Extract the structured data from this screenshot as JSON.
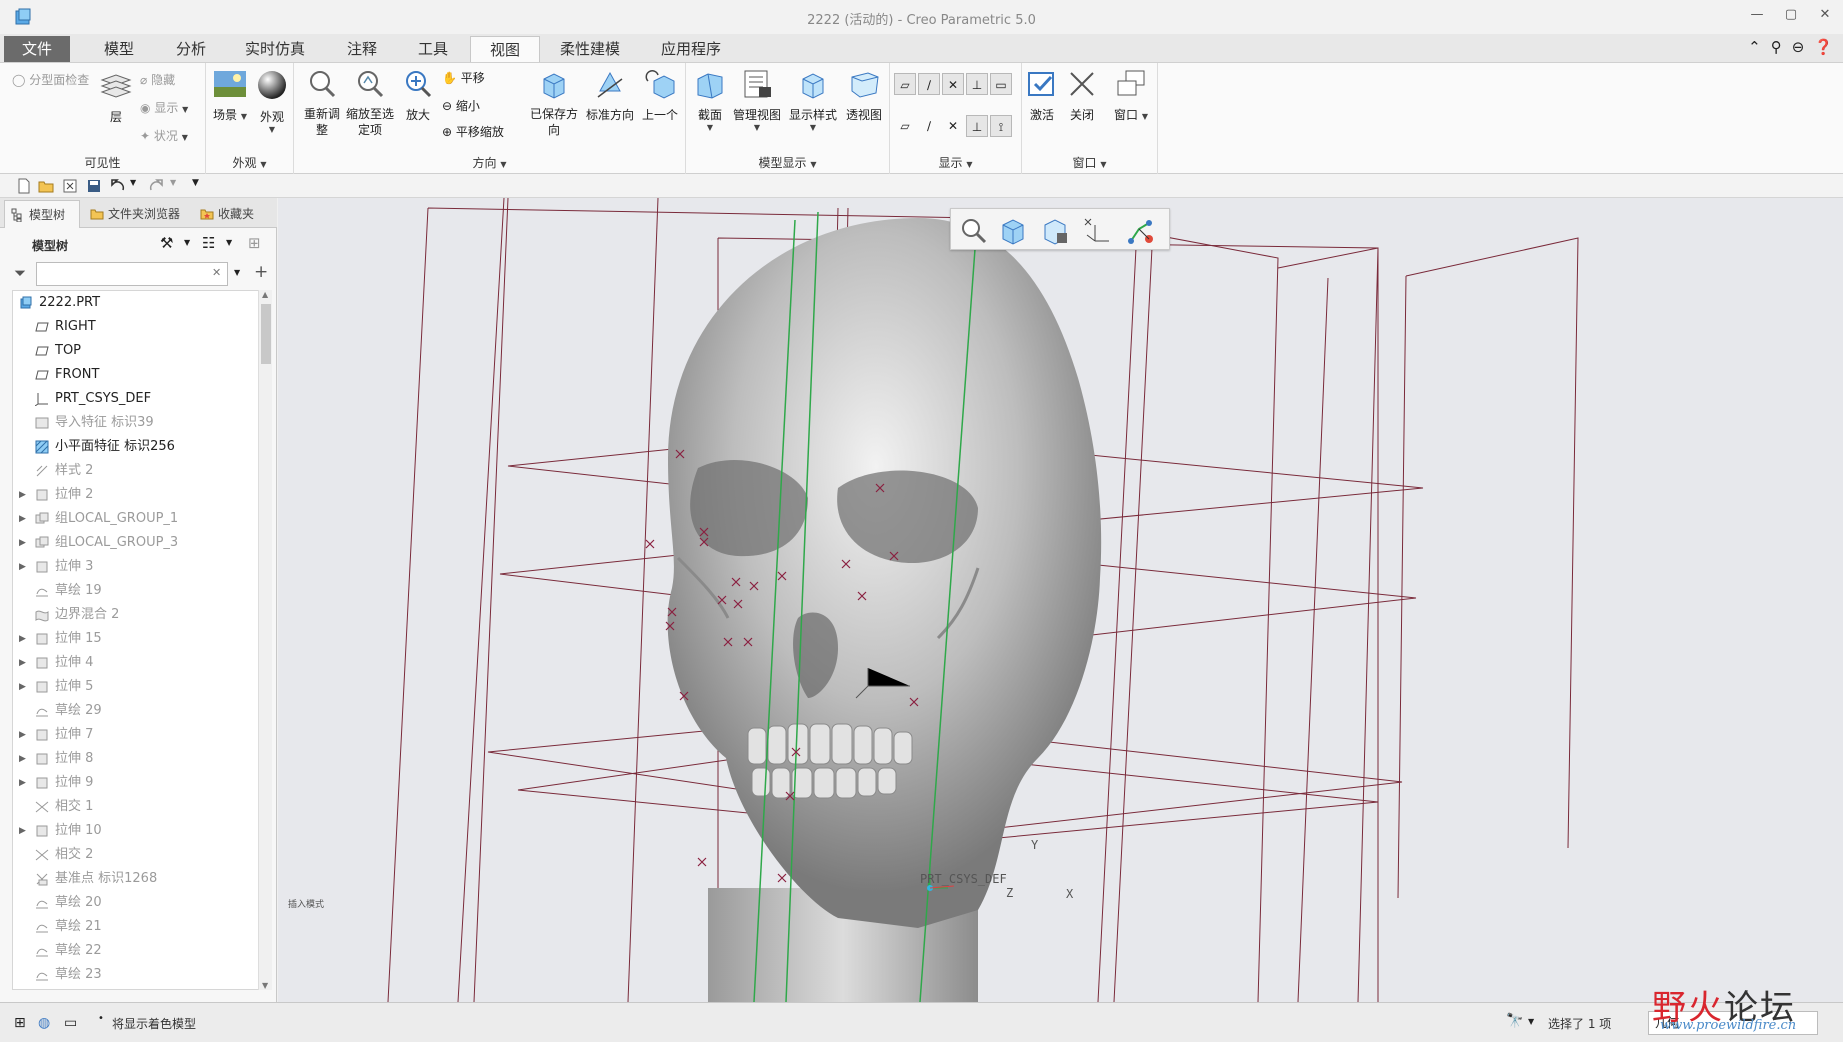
{
  "window": {
    "title": "2222 (活动的) - Creo Parametric 5.0",
    "controls": [
      "minimize-icon",
      "maximize-icon",
      "close-icon"
    ]
  },
  "tabs": [
    {
      "label": "文件"
    },
    {
      "label": "模型"
    },
    {
      "label": "分析"
    },
    {
      "label": "实时仿真"
    },
    {
      "label": "注释"
    },
    {
      "label": "工具"
    },
    {
      "label": "视图"
    },
    {
      "label": "柔性建模"
    },
    {
      "label": "应用程序"
    }
  ],
  "active_tab": "视图",
  "ribbon": {
    "visibility": {
      "label": "可见性",
      "layer_check": "分型面检查",
      "layer": "层",
      "hide": "隐藏",
      "show": "显示",
      "status": "状况"
    },
    "appearance": {
      "label": "外观",
      "scene": "场景",
      "appearance": "外观"
    },
    "orientation": {
      "label": "方向",
      "refit": "重新调整",
      "zoom_to_selected": "缩放至选定项",
      "zoom_in": "放大",
      "pan": "平移",
      "zoom_out": "缩小",
      "pan_zoom": "平移缩放",
      "saved_orientations": "已保存方向",
      "standard_orientation": "标准方向",
      "previous": "上一个"
    },
    "model_display": {
      "label": "模型显示",
      "section": "截面",
      "manage_views": "管理视图",
      "display_style": "显示样式",
      "perspective": "透视图"
    },
    "show": {
      "label": "显示"
    },
    "window": {
      "label": "窗口",
      "activate": "激活",
      "close": "关闭",
      "windows": "窗口"
    }
  },
  "panel": {
    "tabs": [
      {
        "label": "模型树"
      },
      {
        "label": "文件夹浏览器"
      },
      {
        "label": "收藏夹"
      }
    ],
    "tree_title": "模型树",
    "filter_value": "",
    "tree": [
      {
        "label": "2222.PRT",
        "icon": "part-icon",
        "indent": 0,
        "expander": false,
        "dim": false
      },
      {
        "label": "RIGHT",
        "icon": "datum-plane-icon",
        "indent": 1,
        "expander": false,
        "dim": false
      },
      {
        "label": "TOP",
        "icon": "datum-plane-icon",
        "indent": 1,
        "expander": false,
        "dim": false
      },
      {
        "label": "FRONT",
        "icon": "datum-plane-icon",
        "indent": 1,
        "expander": false,
        "dim": false
      },
      {
        "label": "PRT_CSYS_DEF",
        "icon": "csys-icon",
        "indent": 1,
        "expander": false,
        "dim": false
      },
      {
        "label": "导入特征 标识39",
        "icon": "import-icon",
        "indent": 1,
        "expander": false,
        "dim": true
      },
      {
        "label": "小平面特征 标识256",
        "icon": "facet-icon",
        "indent": 1,
        "expander": false,
        "dim": false
      },
      {
        "label": "样式 2",
        "icon": "style-icon",
        "indent": 1,
        "expander": false,
        "dim": true
      },
      {
        "label": "拉伸 2",
        "icon": "extrude-icon",
        "indent": 1,
        "expander": true,
        "dim": true
      },
      {
        "label": "组LOCAL_GROUP_1",
        "icon": "group-icon",
        "indent": 1,
        "expander": true,
        "dim": true
      },
      {
        "label": "组LOCAL_GROUP_3",
        "icon": "group-icon",
        "indent": 1,
        "expander": true,
        "dim": true
      },
      {
        "label": "拉伸 3",
        "icon": "extrude-icon",
        "indent": 1,
        "expander": true,
        "dim": true
      },
      {
        "label": "草绘 19",
        "icon": "sketch-icon",
        "indent": 1,
        "expander": false,
        "dim": true
      },
      {
        "label": "边界混合 2",
        "icon": "boundary-blend-icon",
        "indent": 1,
        "expander": false,
        "dim": true
      },
      {
        "label": "拉伸 15",
        "icon": "extrude-icon",
        "indent": 1,
        "expander": true,
        "dim": true
      },
      {
        "label": "拉伸 4",
        "icon": "extrude-icon",
        "indent": 1,
        "expander": true,
        "dim": true
      },
      {
        "label": "拉伸 5",
        "icon": "extrude-icon",
        "indent": 1,
        "expander": true,
        "dim": true
      },
      {
        "label": "草绘 29",
        "icon": "sketch-icon",
        "indent": 1,
        "expander": false,
        "dim": true
      },
      {
        "label": "拉伸 7",
        "icon": "extrude-icon",
        "indent": 1,
        "expander": true,
        "dim": true
      },
      {
        "label": "拉伸 8",
        "icon": "extrude-icon",
        "indent": 1,
        "expander": true,
        "dim": true
      },
      {
        "label": "拉伸 9",
        "icon": "extrude-icon",
        "indent": 1,
        "expander": true,
        "dim": true
      },
      {
        "label": "相交 1",
        "icon": "intersect-icon",
        "indent": 1,
        "expander": false,
        "dim": true
      },
      {
        "label": "拉伸 10",
        "icon": "extrude-icon",
        "indent": 1,
        "expander": true,
        "dim": true
      },
      {
        "label": "相交 2",
        "icon": "intersect-icon",
        "indent": 1,
        "expander": false,
        "dim": true
      },
      {
        "label": "基准点 标识1268",
        "icon": "datum-point-icon",
        "indent": 1,
        "expander": false,
        "dim": true
      },
      {
        "label": "草绘 20",
        "icon": "sketch-icon",
        "indent": 1,
        "expander": false,
        "dim": true
      },
      {
        "label": "草绘 21",
        "icon": "sketch-icon",
        "indent": 1,
        "expander": false,
        "dim": true
      },
      {
        "label": "草绘 22",
        "icon": "sketch-icon",
        "indent": 1,
        "expander": false,
        "dim": true
      },
      {
        "label": "草绘 23",
        "icon": "sketch-icon",
        "indent": 1,
        "expander": false,
        "dim": true
      }
    ]
  },
  "graphics": {
    "insert_mode": "插入模式",
    "csys_label": "PRT_CSYS_DEF",
    "axis_x": "X",
    "axis_y": "Y",
    "axis_z": "Z",
    "datum_color": "#7a2a3a",
    "model_color": "#c9c9c9"
  },
  "status": {
    "message": "将显示着色模型",
    "selection": "选择了 1 项",
    "filter": "几何"
  },
  "watermark": {
    "text1": "野火",
    "text2": "论坛",
    "url": "www.proewildfire.cn"
  }
}
